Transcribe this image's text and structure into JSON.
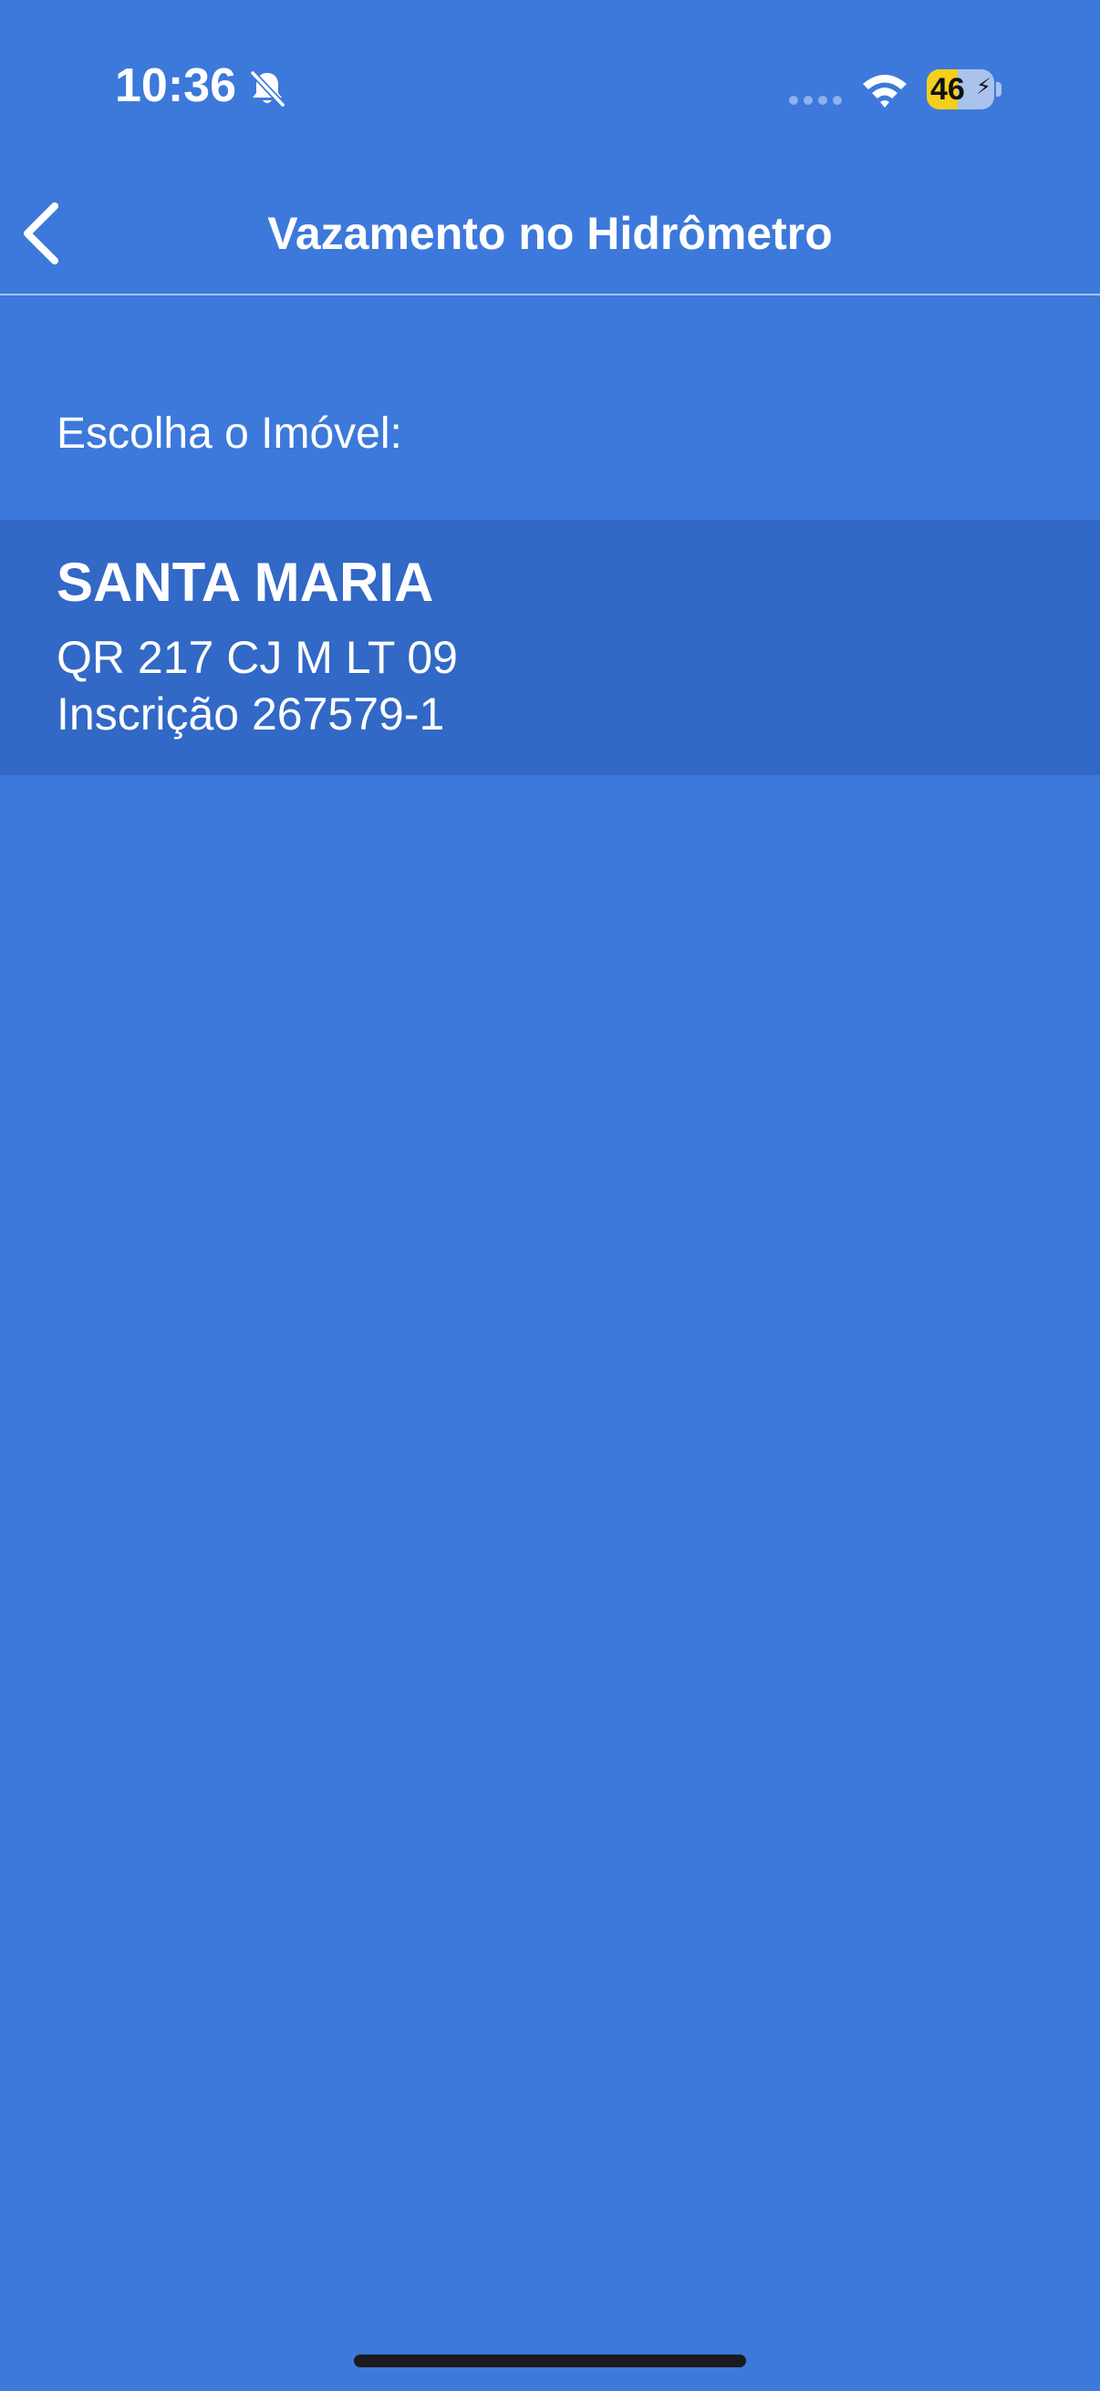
{
  "status_bar": {
    "time": "10:36",
    "battery_level": "46",
    "battery_fraction": 0.46,
    "icons": [
      "bell-slash-icon",
      "cellular-signal-icon",
      "wifi-icon",
      "battery-charging-icon"
    ]
  },
  "nav": {
    "title": "Vazamento no Hidrômetro",
    "back_icon": "chevron-left-icon"
  },
  "content": {
    "section_label": "Escolha o Imóvel:",
    "properties": [
      {
        "name": "SANTA MARIA",
        "address": "QR 217 CJ M LT 09",
        "registration": "Inscrição 267579-1"
      }
    ]
  },
  "colors": {
    "background": "#3c79db",
    "card": "#3268c6",
    "battery_fill": "#f4cf1b",
    "text": "#ffffff"
  }
}
